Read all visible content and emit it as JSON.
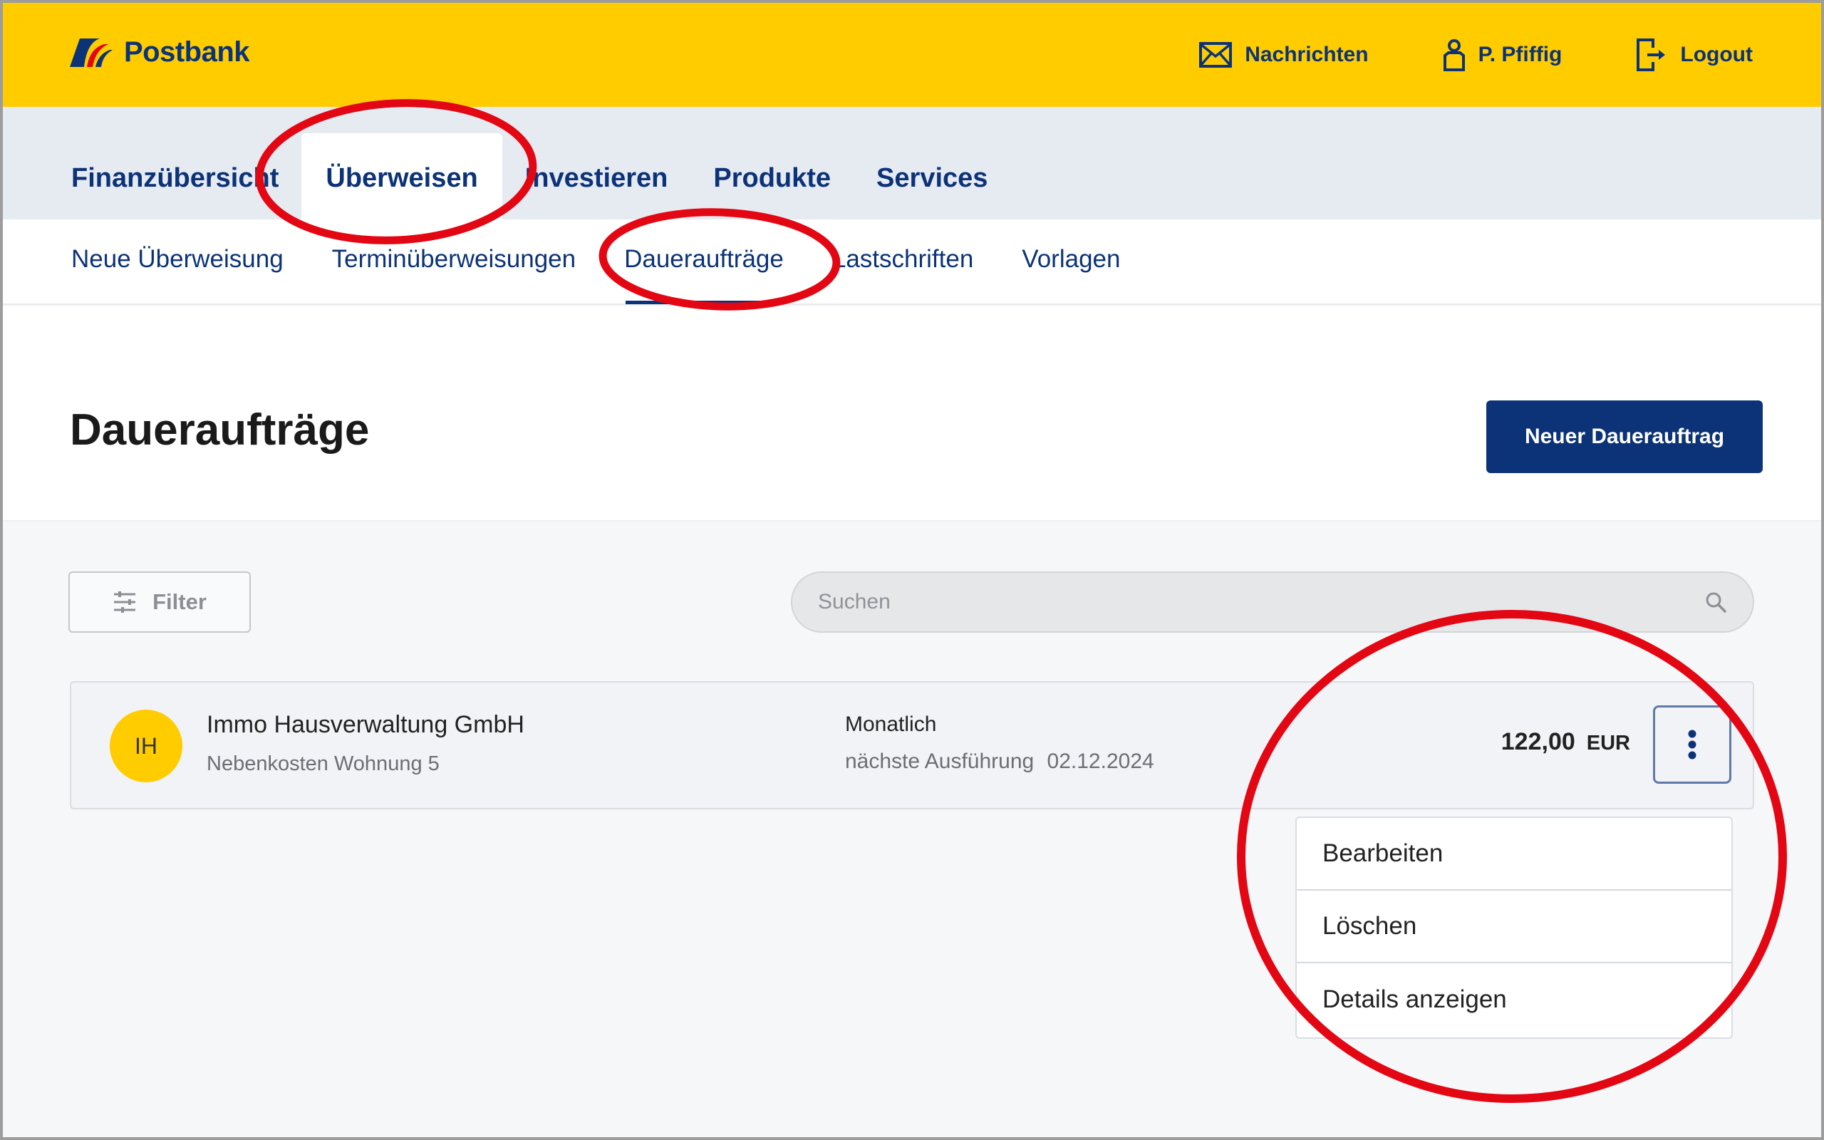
{
  "brand": {
    "name": "Postbank",
    "colors": {
      "yellow": "#ffcc00",
      "navy": "#0c3378",
      "red": "#e30613"
    }
  },
  "header": {
    "actions": [
      {
        "label": "Nachrichten",
        "icon": "mail-icon"
      },
      {
        "label": "P. Pfiffig",
        "icon": "user-icon"
      },
      {
        "label": "Logout",
        "icon": "logout-icon"
      }
    ]
  },
  "main_nav": {
    "items": [
      {
        "label": "Finanzübersicht",
        "active": false
      },
      {
        "label": "Überweisen",
        "active": true
      },
      {
        "label": "Investieren",
        "active": false
      },
      {
        "label": "Produkte",
        "active": false
      },
      {
        "label": "Services",
        "active": false
      }
    ]
  },
  "sub_nav": {
    "items": [
      {
        "label": "Neue Überweisung",
        "active": false
      },
      {
        "label": "Terminüberweisungen",
        "active": false
      },
      {
        "label": "Daueraufträge",
        "active": true
      },
      {
        "label": "Lastschriften",
        "active": false
      },
      {
        "label": "Vorlagen",
        "active": false
      }
    ]
  },
  "page": {
    "title": "Daueraufträge",
    "new_button_label": "Neuer Dauerauftrag"
  },
  "toolbar": {
    "filter_label": "Filter",
    "search_placeholder": "Suchen",
    "search_value": ""
  },
  "standing_orders": [
    {
      "initials": "IH",
      "payee": "Immo Hausverwaltung GmbH",
      "purpose": "Nebenkosten Wohnung 5",
      "frequency": "Monatlich",
      "next_execution_label": "nächste Ausführung",
      "next_execution_date": "02.12.2024",
      "amount": "122,00",
      "currency": "EUR"
    }
  ],
  "context_menu": {
    "items": [
      {
        "label": "Bearbeiten"
      },
      {
        "label": "Löschen"
      },
      {
        "label": "Details anzeigen"
      }
    ]
  },
  "annotations": {
    "highlight_color": "#e30613",
    "highlighted": [
      "Überweisen",
      "Daueraufträge",
      "context-menu"
    ]
  }
}
